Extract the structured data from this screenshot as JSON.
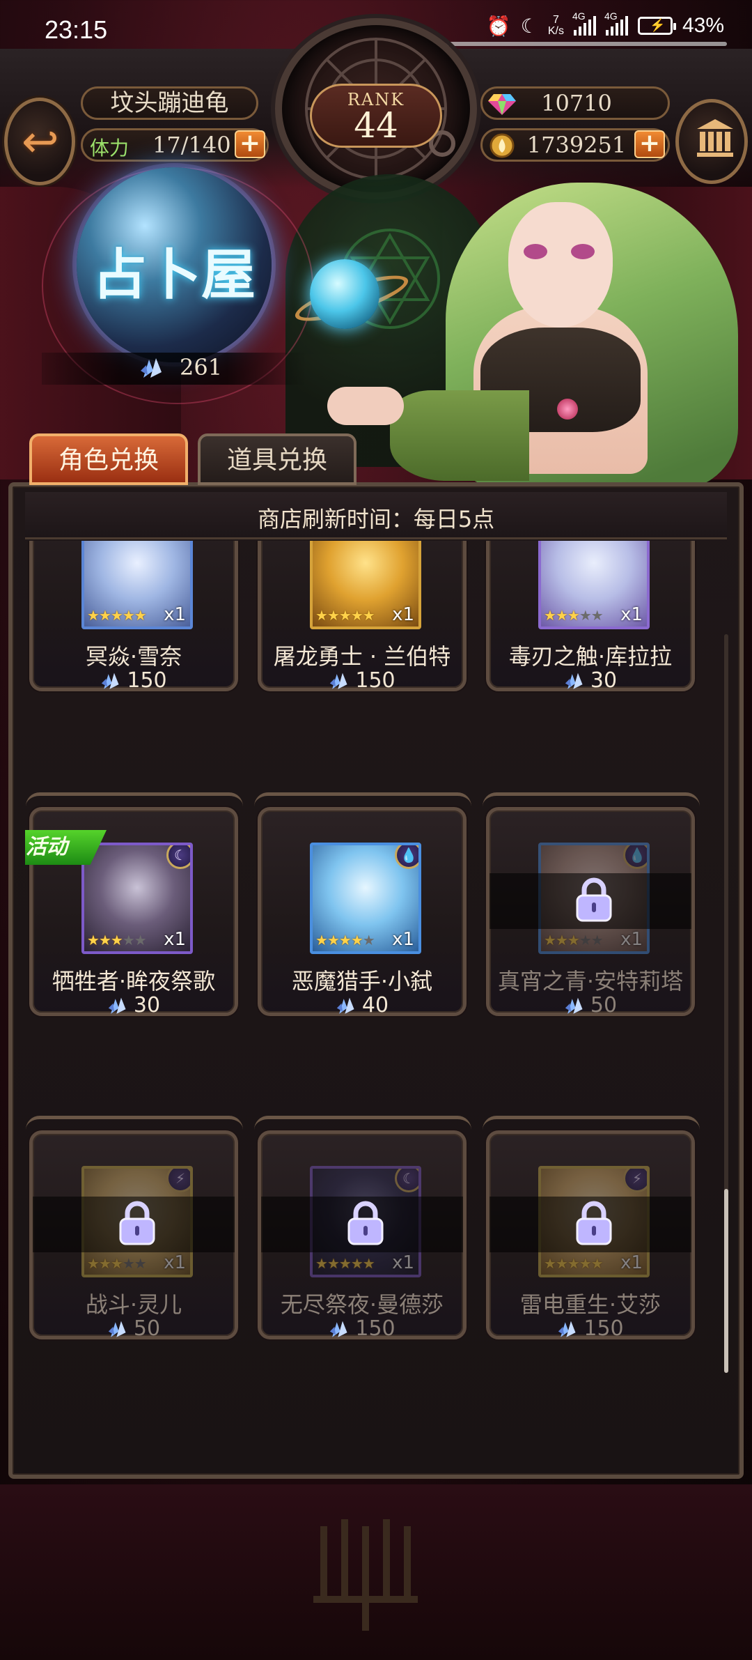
{
  "status_bar": {
    "time": "23:15",
    "net_speed_top": "7",
    "net_speed_unit": "K/s",
    "signal1_label": "4G",
    "signal2_label": "4G",
    "battery": "43%"
  },
  "header": {
    "player_name": "坟头蹦迪龟",
    "stamina_label": "体力",
    "stamina_value": "17/140",
    "rank_label": "RANK",
    "rank_value": "44",
    "gems": "10710",
    "gold": "1739251",
    "plus_symbol": "+"
  },
  "shop": {
    "title": "占卜屋",
    "shard_balance": "261",
    "tabs": [
      {
        "label": "角色兑换",
        "active": true
      },
      {
        "label": "道具兑换",
        "active": false
      }
    ],
    "refresh_notice": "商店刷新时间：每日5点"
  },
  "items": [
    {
      "name": "冥焱·雪奈",
      "price": "150",
      "stars": 5,
      "qty": "x1",
      "locked": false,
      "event": false,
      "art": [
        "#e9f0ff",
        "#9fb6e3",
        "#4a5f9a"
      ],
      "frame": "#5b86d6",
      "element": ""
    },
    {
      "name": "屠龙勇士 · 兰伯特",
      "price": "150",
      "stars": 5,
      "qty": "x1",
      "locked": false,
      "event": false,
      "art": [
        "#ffe28a",
        "#e0a230",
        "#7a4b12"
      ],
      "frame": "#d6a33a",
      "element": ""
    },
    {
      "name": "毒刃之触·库拉拉",
      "price": "30",
      "stars": 3,
      "qty": "x1",
      "locked": false,
      "event": false,
      "art": [
        "#e9eefc",
        "#b7bde6",
        "#6e5aa8"
      ],
      "frame": "#8b6ad0",
      "element": ""
    },
    {
      "name": "牺牲者·眸夜祭歌",
      "price": "30",
      "stars": 3,
      "qty": "x1",
      "locked": false,
      "event": true,
      "event_label": "活动",
      "art": [
        "#c9c2d6",
        "#6b5d7a",
        "#2a2233"
      ],
      "frame": "#7d5ac8",
      "element": "☾"
    },
    {
      "name": "恶魔猎手·小弑",
      "price": "40",
      "stars": 4,
      "qty": "x1",
      "locked": false,
      "event": false,
      "art": [
        "#e6f6ff",
        "#7fc4ef",
        "#2a5e9a"
      ],
      "frame": "#4a8fe0",
      "element": "💧"
    },
    {
      "name": "真宵之青·安特莉塔",
      "price": "50",
      "stars": 3,
      "qty": "x1",
      "locked": true,
      "event": false,
      "art": [
        "#f0d8d0",
        "#b99a8e",
        "#5a4640"
      ],
      "frame": "#4a8fe0",
      "element": "💧"
    },
    {
      "name": "战斗·灵儿",
      "price": "50",
      "stars": 3,
      "qty": "x1",
      "locked": true,
      "event": false,
      "art": [
        "#fbe7b8",
        "#d6b36a",
        "#6e5522"
      ],
      "frame": "#c9b04a",
      "element": "⚡"
    },
    {
      "name": "无尽祭夜·曼德莎",
      "price": "150",
      "stars": 5,
      "qty": "x1",
      "locked": true,
      "event": false,
      "art": [
        "#6a6a9a",
        "#2e2e56",
        "#141428"
      ],
      "frame": "#7d5ac8",
      "element": "☾"
    },
    {
      "name": "雷电重生·艾莎",
      "price": "150",
      "stars": 5,
      "qty": "x1",
      "locked": true,
      "event": false,
      "art": [
        "#fbe7b8",
        "#d8b06a",
        "#7a5a22"
      ],
      "frame": "#c9b04a",
      "element": "⚡"
    }
  ],
  "colors": {
    "accent_orange": "#d86a38",
    "event_green": "#3dbb22",
    "star_gold": "#ffd24a"
  }
}
